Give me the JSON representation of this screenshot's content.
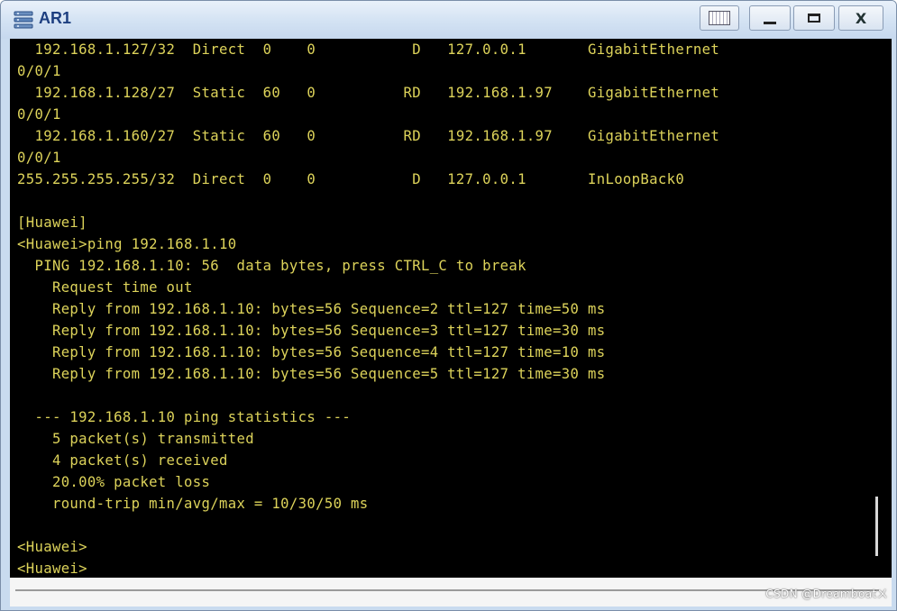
{
  "window": {
    "title": "AR1",
    "icon": "router-app-icon"
  },
  "controls": {
    "restore": "restore-icon",
    "minimize": "minimize-icon",
    "maximize": "maximize-icon",
    "close": "X"
  },
  "terminal": {
    "text_color": "#ddd35a",
    "background": "#000000",
    "lines": [
      "  192.168.1.127/32  Direct  0    0           D   127.0.0.1       GigabitEthernet",
      "0/0/1",
      "  192.168.1.128/27  Static  60   0          RD   192.168.1.97    GigabitEthernet",
      "0/0/1",
      "  192.168.1.160/27  Static  60   0          RD   192.168.1.97    GigabitEthernet",
      "0/0/1",
      "255.255.255.255/32  Direct  0    0           D   127.0.0.1       InLoopBack0",
      "",
      "[Huawei]",
      "<Huawei>ping 192.168.1.10",
      "  PING 192.168.1.10: 56  data bytes, press CTRL_C to break",
      "    Request time out",
      "    Reply from 192.168.1.10: bytes=56 Sequence=2 ttl=127 time=50 ms",
      "    Reply from 192.168.1.10: bytes=56 Sequence=3 ttl=127 time=30 ms",
      "    Reply from 192.168.1.10: bytes=56 Sequence=4 ttl=127 time=10 ms",
      "    Reply from 192.168.1.10: bytes=56 Sequence=5 ttl=127 time=30 ms",
      "",
      "  --- 192.168.1.10 ping statistics ---",
      "    5 packet(s) transmitted",
      "    4 packet(s) received",
      "    20.00% packet loss",
      "    round-trip min/avg/max = 10/30/50 ms",
      "",
      "<Huawei>",
      "<Huawei>"
    ]
  },
  "watermark": "CSDN @Dreamboatㄨ"
}
